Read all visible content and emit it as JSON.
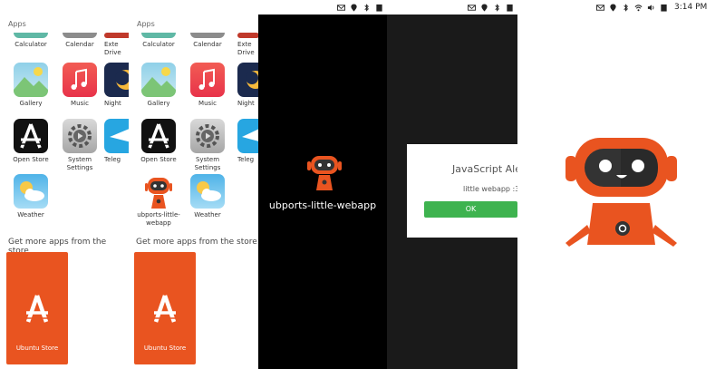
{
  "status_bar": {
    "time": "3:14 PM",
    "icons": [
      "mail-icon",
      "location-icon",
      "bluetooth-icon",
      "wifi-icon",
      "volume-icon",
      "battery-icon"
    ]
  },
  "launcher": {
    "section_label": "Apps",
    "partial_row": [
      "Calculator",
      "Calendar",
      "Exte Drive"
    ],
    "apps_left": [
      "Gallery",
      "Music",
      "Night",
      "Open Store",
      "System Settings",
      "Teleg",
      "Weather"
    ],
    "apps_right": [
      "Gallery",
      "Music",
      "Night",
      "Open Store",
      "System Settings",
      "Teleg",
      "ubports-little-webapp",
      "Weather"
    ],
    "store_heading": "Get more apps from the store",
    "store_tile": "Ubuntu Store"
  },
  "splash": {
    "title": "ubports-little-webapp"
  },
  "alert": {
    "title": "JavaScript Ale",
    "message": "little webapp :3)",
    "ok_label": "OK"
  },
  "colors": {
    "ubuntu_orange": "#e95420",
    "ok_green": "#3eb34f",
    "dark_bg": "#111111"
  }
}
